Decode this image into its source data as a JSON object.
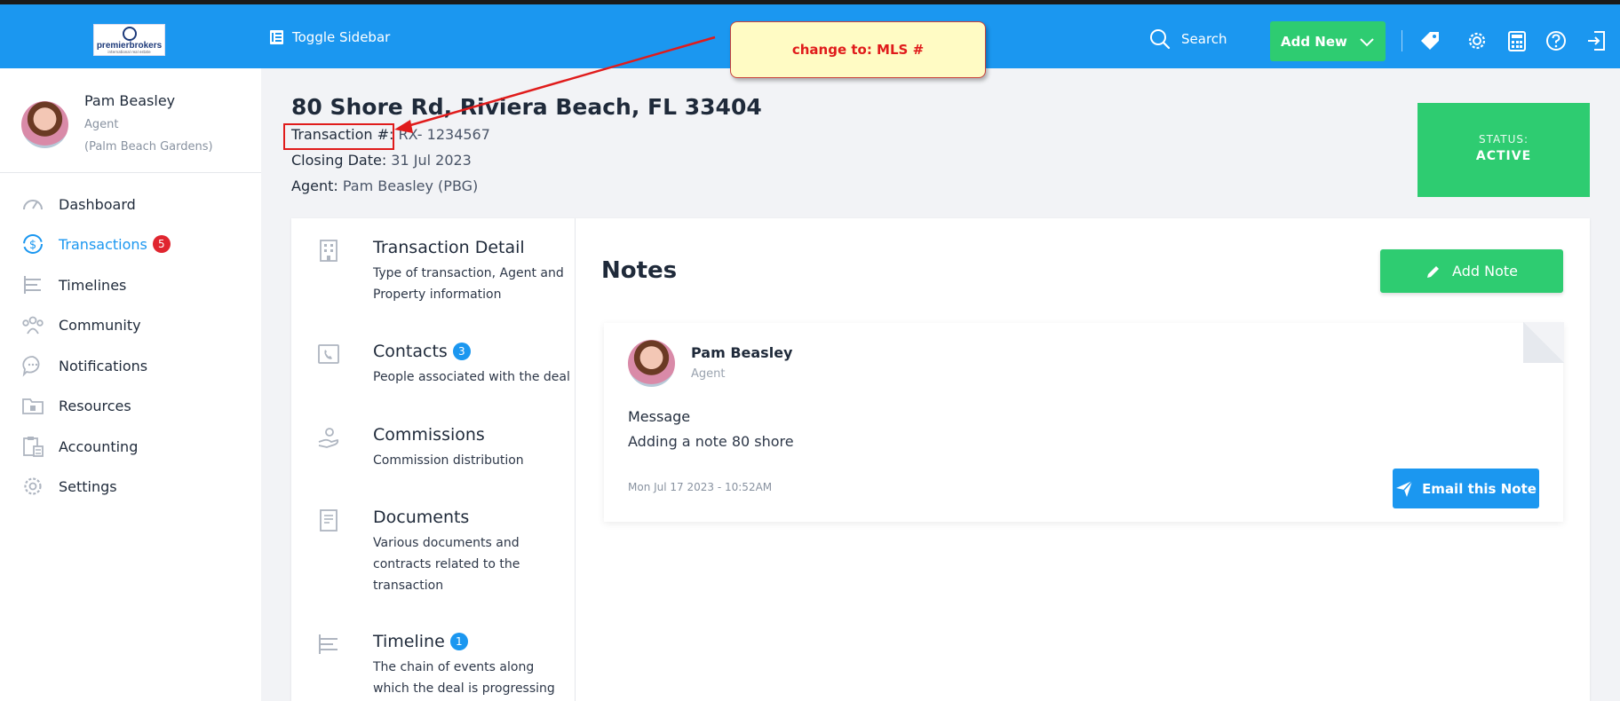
{
  "topbar": {
    "logo_text": "premierbrokers",
    "logo_subtext": "international real estate",
    "toggle_label": "Toggle Sidebar",
    "search_label": "Search",
    "add_new_label": "Add New",
    "icons": [
      "tag-icon",
      "gear-icon",
      "calculator-icon",
      "help-icon",
      "logout-icon"
    ],
    "colors": {
      "bar": "#1b97f0",
      "accent_green": "#2ecc71"
    }
  },
  "annotation": {
    "callout_text": "change to: MLS #"
  },
  "profile": {
    "name": "Pam Beasley",
    "role": "Agent",
    "location": "(Palm Beach Gardens)"
  },
  "sidebar": {
    "items": [
      {
        "label": "Dashboard",
        "icon": "gauge-icon",
        "active": false
      },
      {
        "label": "Transactions",
        "icon": "dollar-cycle-icon",
        "active": true,
        "badge": "5"
      },
      {
        "label": "Timelines",
        "icon": "timeline-icon",
        "active": false
      },
      {
        "label": "Community",
        "icon": "people-icon",
        "active": false
      },
      {
        "label": "Notifications",
        "icon": "chat-bubble-icon",
        "active": false
      },
      {
        "label": "Resources",
        "icon": "folder-icon",
        "active": false
      },
      {
        "label": "Accounting",
        "icon": "clipboard-calculator-icon",
        "active": false
      },
      {
        "label": "Settings",
        "icon": "gear-icon",
        "active": false
      }
    ]
  },
  "transaction": {
    "address": "80 Shore Rd, Riviera Beach, FL 33404",
    "number_label": "Transaction #:",
    "number_value": "RX- 1234567",
    "closing_label": "Closing Date:",
    "closing_value": "31 Jul 2023",
    "agent_label": "Agent:",
    "agent_value": "Pam Beasley (PBG)",
    "status_label": "STATUS:",
    "status_value": "ACTIVE"
  },
  "sections": [
    {
      "title": "Transaction Detail",
      "desc": "Type of transaction, Agent and Property information",
      "icon": "building-icon"
    },
    {
      "title": "Contacts",
      "badge": "3",
      "desc": "People associated with the deal",
      "icon": "phone-book-icon"
    },
    {
      "title": "Commissions",
      "desc": "Commission distribution",
      "icon": "hand-money-icon"
    },
    {
      "title": "Documents",
      "desc": "Various documents and contracts related to the transaction",
      "icon": "document-icon"
    },
    {
      "title": "Timeline",
      "badge": "1",
      "desc": "The chain of events along which the deal is progressing",
      "icon": "timeline-icon"
    }
  ],
  "notes": {
    "heading": "Notes",
    "add_label": "Add Note",
    "items": [
      {
        "author": "Pam Beasley",
        "role": "Agent",
        "message_label": "Message",
        "message": "Adding a note 80 shore",
        "date": "Mon Jul 17 2023 - 10:52AM",
        "email_label": "Email this Note"
      }
    ]
  }
}
